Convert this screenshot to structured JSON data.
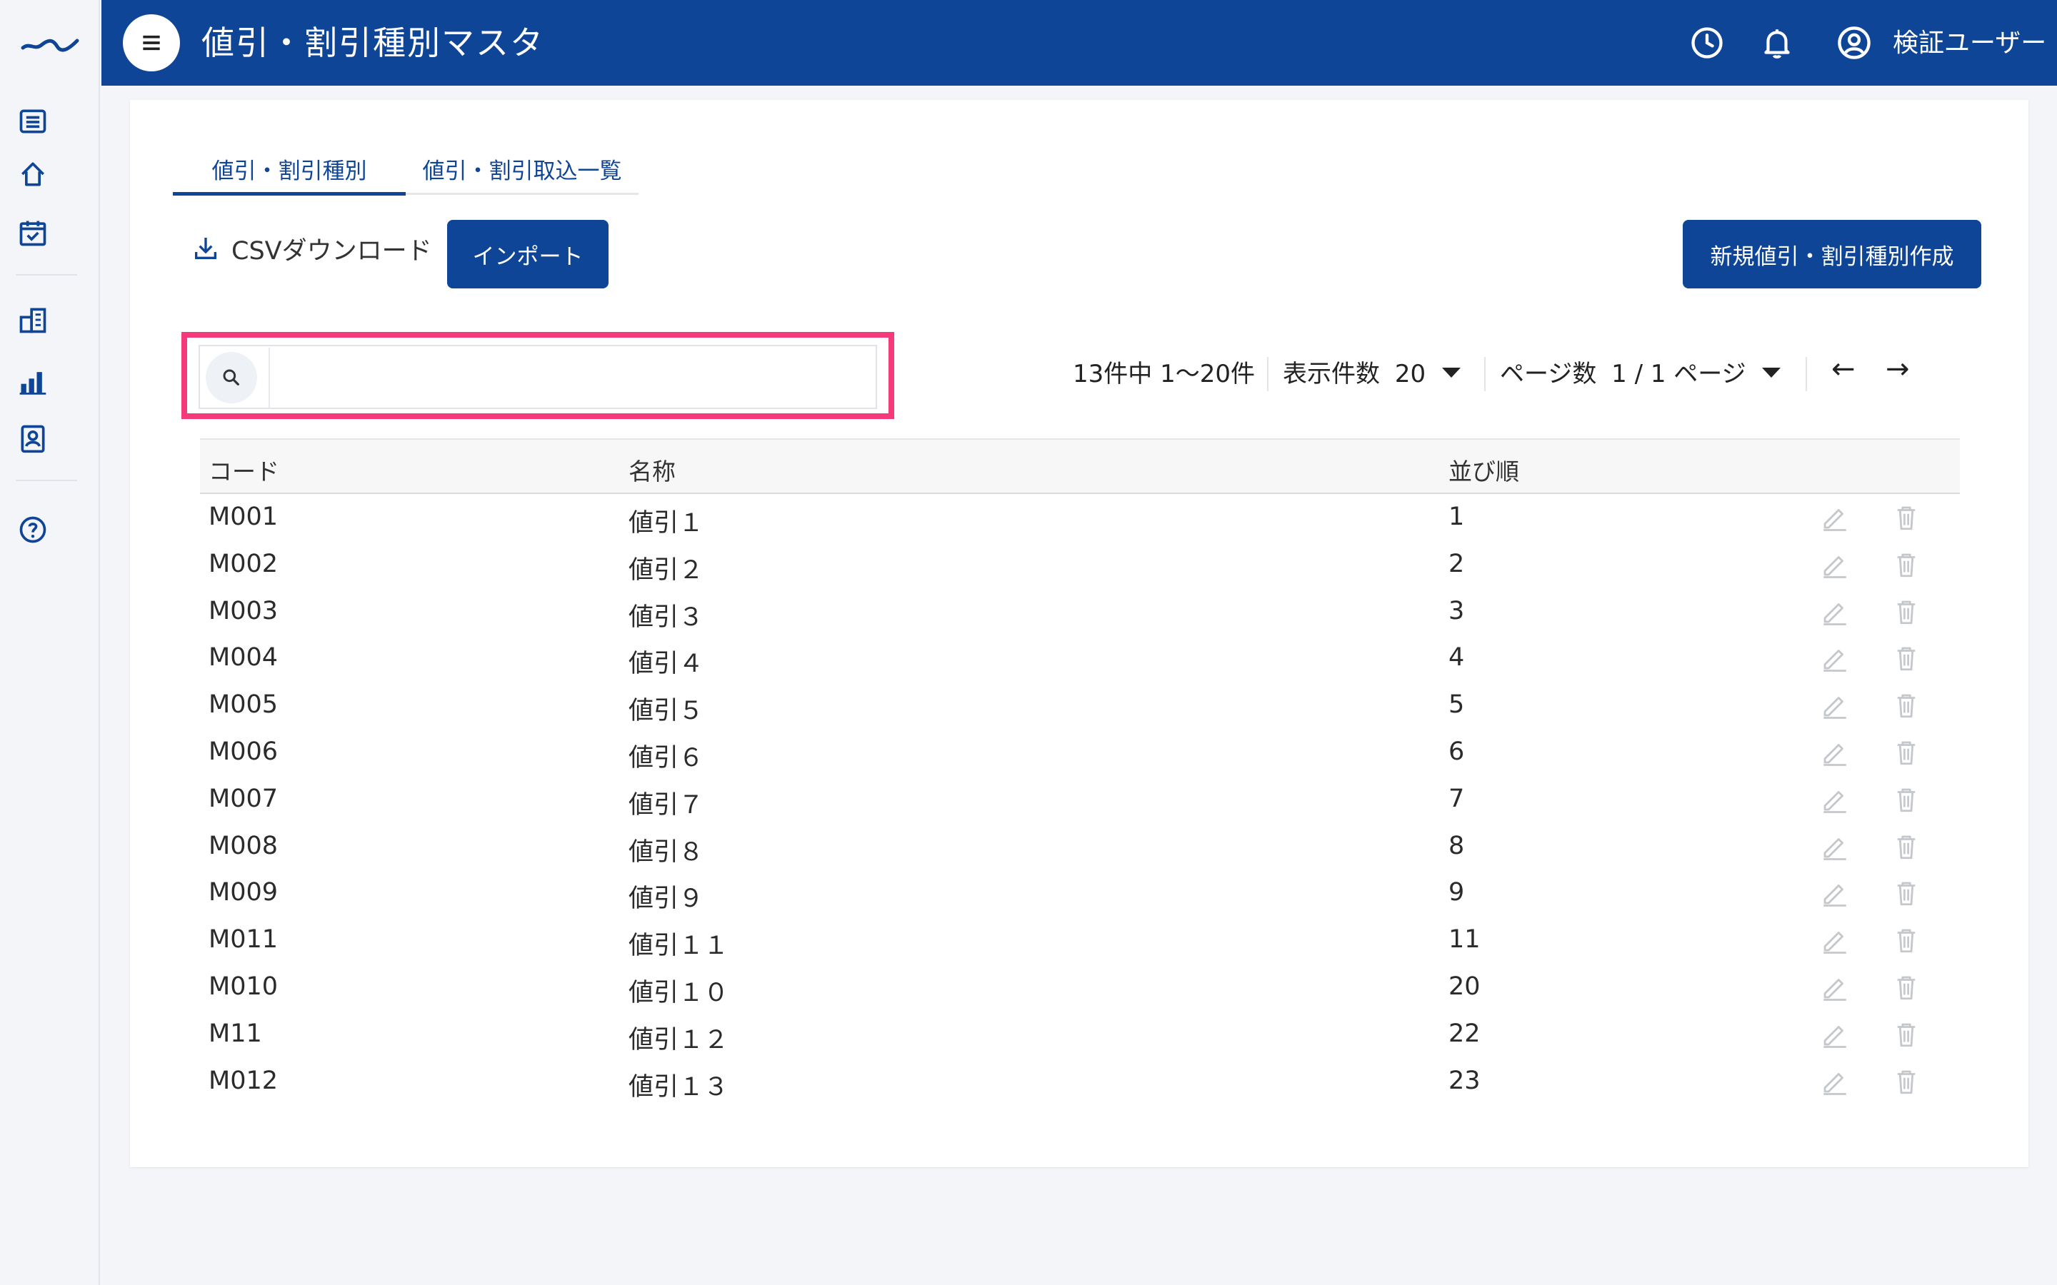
{
  "header": {
    "title": "値引・割引種別マスタ",
    "user_name": "検証ユーザー"
  },
  "sidebar": {
    "items": [
      {
        "icon": "logo-icon"
      },
      {
        "icon": "list-icon"
      },
      {
        "icon": "home-icon"
      },
      {
        "icon": "calendar-check-icon"
      },
      {
        "icon": "building-icon"
      },
      {
        "icon": "bar-chart-icon"
      },
      {
        "icon": "id-badge-icon"
      },
      {
        "icon": "help-icon"
      }
    ]
  },
  "tabs": [
    {
      "label": "値引・割引種別",
      "active": true
    },
    {
      "label": "値引・割引取込一覧",
      "active": false
    }
  ],
  "toolbar": {
    "csv_label": "CSVダウンロード",
    "import_label": "インポート",
    "new_label": "新規値引・割引種別作成"
  },
  "search": {
    "placeholder": "",
    "value": ""
  },
  "pagination": {
    "range_text": "13件中 1〜20件",
    "per_page_label": "表示件数",
    "per_page_value": "20",
    "page_label": "ページ数",
    "page_value": "1 / 1 ページ",
    "prev": "←",
    "next": "→"
  },
  "table": {
    "columns": [
      "コード",
      "名称",
      "並び順"
    ],
    "rows": [
      {
        "code": "M001",
        "name": "値引１",
        "order": "1"
      },
      {
        "code": "M002",
        "name": "値引２",
        "order": "2"
      },
      {
        "code": "M003",
        "name": "値引３",
        "order": "3"
      },
      {
        "code": "M004",
        "name": "値引４",
        "order": "4"
      },
      {
        "code": "M005",
        "name": "値引５",
        "order": "5"
      },
      {
        "code": "M006",
        "name": "値引６",
        "order": "6"
      },
      {
        "code": "M007",
        "name": "値引７",
        "order": "7"
      },
      {
        "code": "M008",
        "name": "値引８",
        "order": "8"
      },
      {
        "code": "M009",
        "name": "値引９",
        "order": "9"
      },
      {
        "code": "M011",
        "name": "値引１１",
        "order": "11"
      },
      {
        "code": "M010",
        "name": "値引１０",
        "order": "20"
      },
      {
        "code": "M11",
        "name": "値引１２",
        "order": "22"
      },
      {
        "code": "M012",
        "name": "値引１３",
        "order": "23"
      }
    ]
  },
  "colors": {
    "primary": "#0f4596",
    "highlight": "#f43a7a",
    "background": "#f3f5f8"
  }
}
